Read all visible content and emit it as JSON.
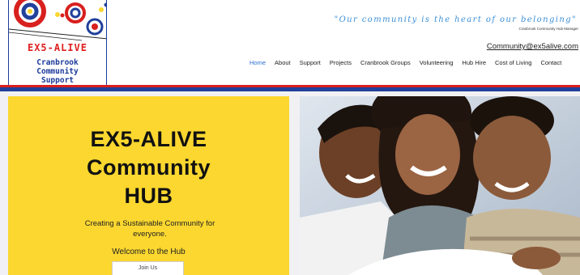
{
  "logo": {
    "title": "EX5-ALIVE",
    "subtitle_lines": [
      "Cranbrook",
      "Community",
      "Support"
    ]
  },
  "header": {
    "quote": "\"Our community is the heart of our belonging\"",
    "quote_credit": "Cranbrook Community Hub Manager",
    "email": "Community@ex5alive.com"
  },
  "nav": {
    "items": [
      "Home",
      "About",
      "Support",
      "Projects",
      "Cranbrook Groups",
      "Volunteering",
      "Hub Hire",
      "Cost of Living",
      "Contact"
    ],
    "active": "Home"
  },
  "hero": {
    "title_lines": [
      "EX5-ALIVE",
      "Community",
      "HUB"
    ],
    "subtitle": "Creating a Sustainable Community for everyone.",
    "welcome": "Welcome to the Hub",
    "join_button": "Join Us"
  },
  "colors": {
    "brand_red": "#d8201e",
    "brand_blue": "#20409a",
    "hero_yellow": "#fbd72f",
    "nav_active": "#2a6fd1",
    "quote_blue": "#3a8fd8"
  }
}
